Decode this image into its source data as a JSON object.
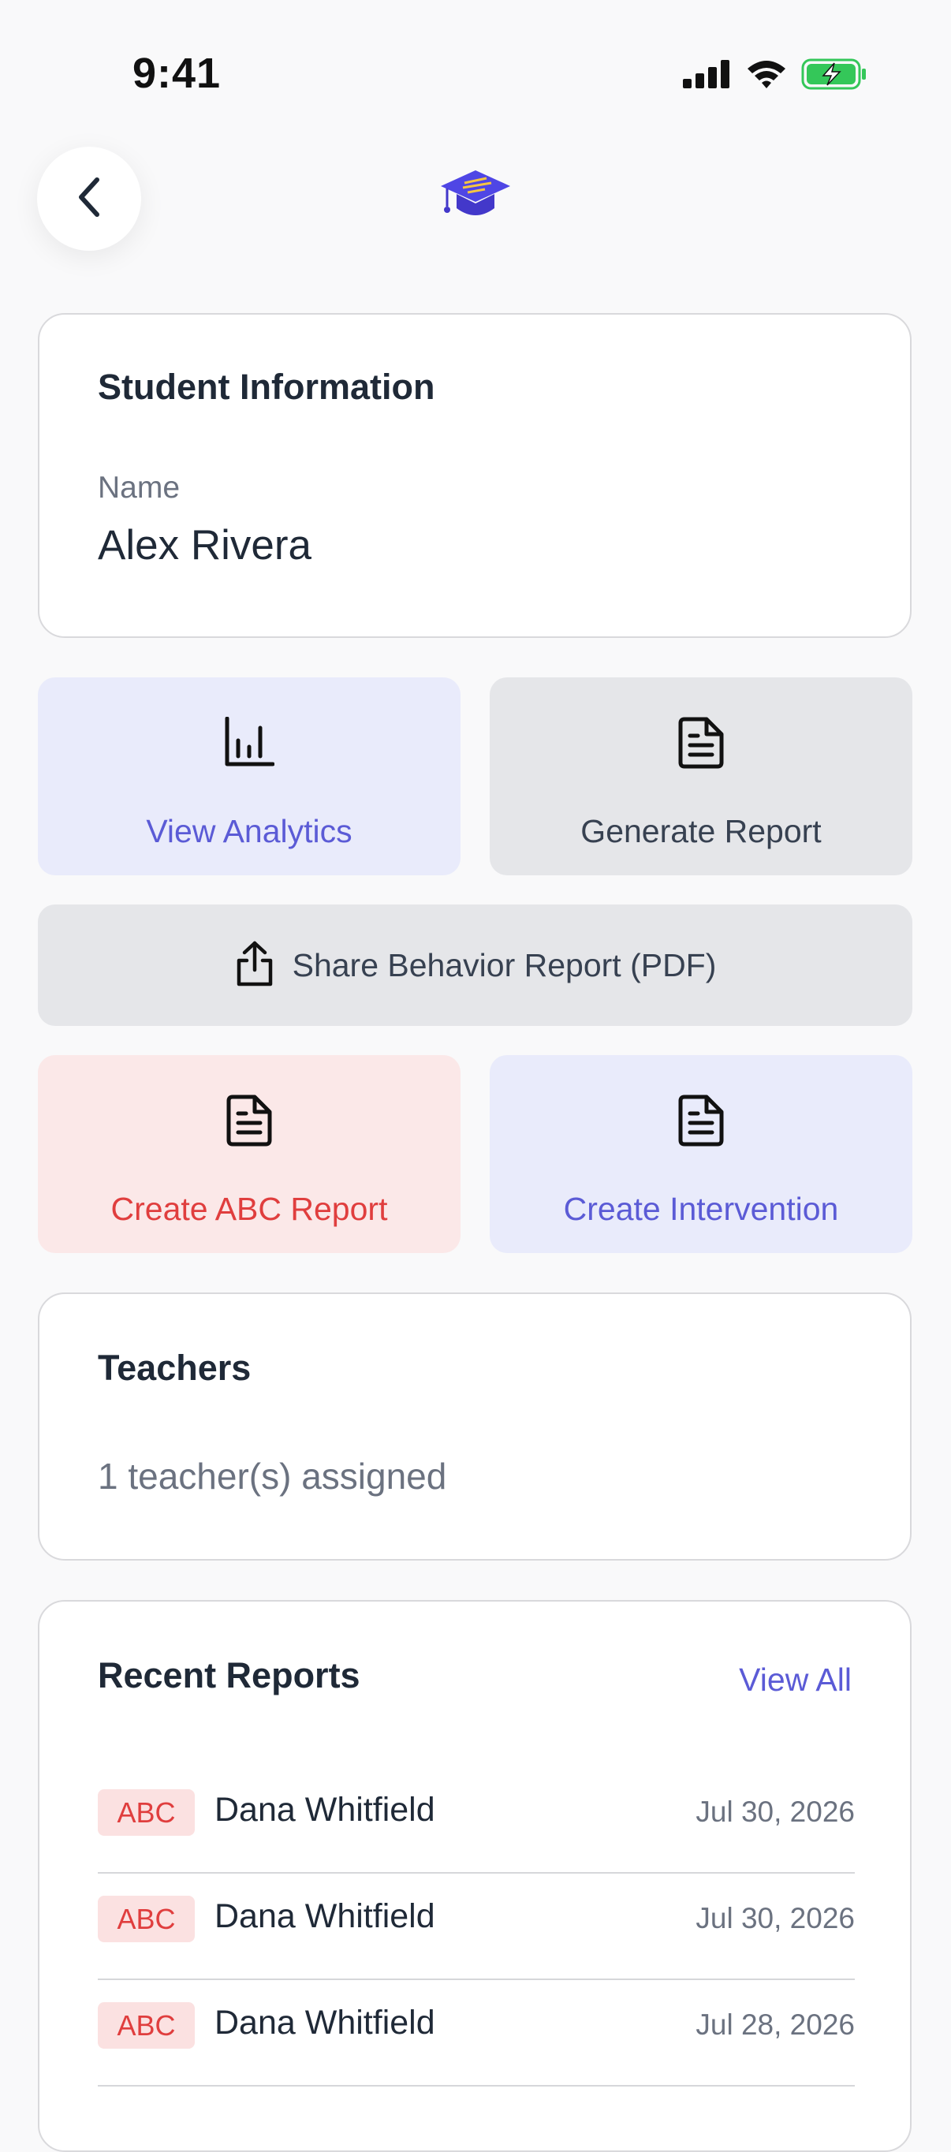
{
  "status_bar": {
    "time": "9:41",
    "icons": [
      "signal-icon",
      "wifi-icon",
      "battery-charging-icon"
    ]
  },
  "header": {
    "back_icon": "chevron-left-icon",
    "logo_icon": "graduation-cap-icon"
  },
  "student_card": {
    "title": "Student Information",
    "name_label": "Name",
    "name_value": "Alex Rivera"
  },
  "actions": {
    "view_analytics": "View Analytics",
    "generate_report": "Generate Report",
    "share_report": "Share Behavior Report (PDF)",
    "create_abc_report": "Create ABC Report",
    "create_intervention": "Create Intervention"
  },
  "teachers_card": {
    "title": "Teachers",
    "summary": "1 teacher(s) assigned"
  },
  "recent_reports": {
    "title": "Recent Reports",
    "view_all": "View All",
    "items": [
      {
        "type": "ABC",
        "teacher": "Dana Whitfield",
        "date": "Jul 30, 2026"
      },
      {
        "type": "ABC",
        "teacher": "Dana Whitfield",
        "date": "Jul 30, 2026"
      },
      {
        "type": "ABC",
        "teacher": "Dana Whitfield",
        "date": "Jul 28, 2026"
      }
    ]
  },
  "colors": {
    "accent": "#5b5bd6",
    "danger": "#e03e3e",
    "battery": "#34c759"
  }
}
